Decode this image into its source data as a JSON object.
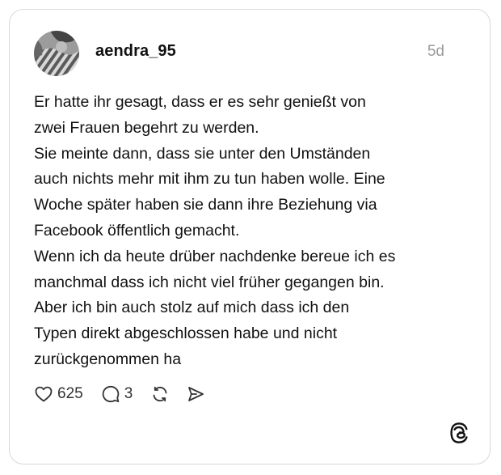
{
  "post": {
    "username": "aendra_95",
    "timestamp": "5d",
    "lines": [
      "Er hatte ihr gesagt, dass er es sehr genießt von",
      "zwei Frauen begehrt zu werden.",
      "Sie meinte dann, dass sie unter den Umständen",
      "auch nichts mehr mit ihm zu tun haben wolle. Eine",
      "Woche später haben sie dann ihre Beziehung via",
      "Facebook öffentlich gemacht.",
      "Wenn ich da heute drüber nachdenke bereue ich es",
      "manchmal dass ich nicht viel früher gegangen bin.",
      "Aber ich bin auch stolz auf mich dass ich den",
      "Typen direkt abgeschlossen habe und nicht",
      "zurückgenommen ha"
    ],
    "actions": {
      "likes": "625",
      "replies": "3"
    },
    "icons": {
      "like": "heart-icon",
      "reply": "comment-icon",
      "repost": "repost-icon",
      "share": "send-icon",
      "brand": "threads-logo-icon"
    }
  }
}
